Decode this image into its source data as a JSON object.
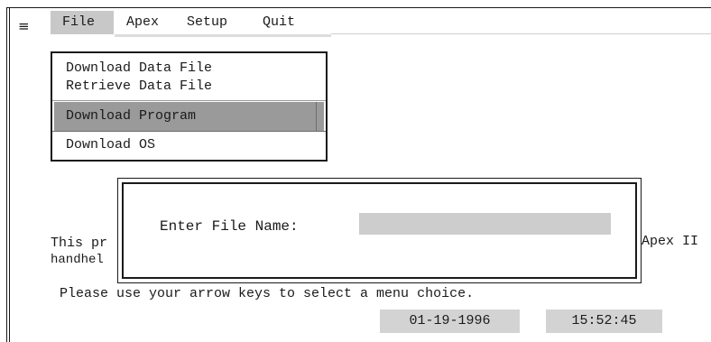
{
  "menubar": {
    "system_icon": "≡",
    "items": [
      {
        "label": "File",
        "selected": true
      },
      {
        "label": "Apex"
      },
      {
        "label": "Setup"
      },
      {
        "label": "Quit"
      }
    ]
  },
  "file_menu": {
    "items": [
      {
        "label": "Download Data File"
      },
      {
        "label": "Retrieve Data File"
      },
      {
        "label": "Download Program",
        "highlighted": true
      },
      {
        "label": "Download OS"
      }
    ]
  },
  "dialog": {
    "label": "Enter File Name:",
    "input_value": ""
  },
  "background_text": {
    "line1_left": "This pr",
    "line2_left": "handhel",
    "line1_right": "Apex II"
  },
  "instructions": "Please use your arrow keys to select a menu choice.",
  "status": {
    "date": "01-19-1996",
    "time": "15:52:45"
  },
  "colors": {
    "menu_selected_bg": "#c8c8c8",
    "menu_highlight_bg": "#9a9a9a",
    "field_bg": "#cdcdcd",
    "status_bg": "#d3d3d3"
  }
}
